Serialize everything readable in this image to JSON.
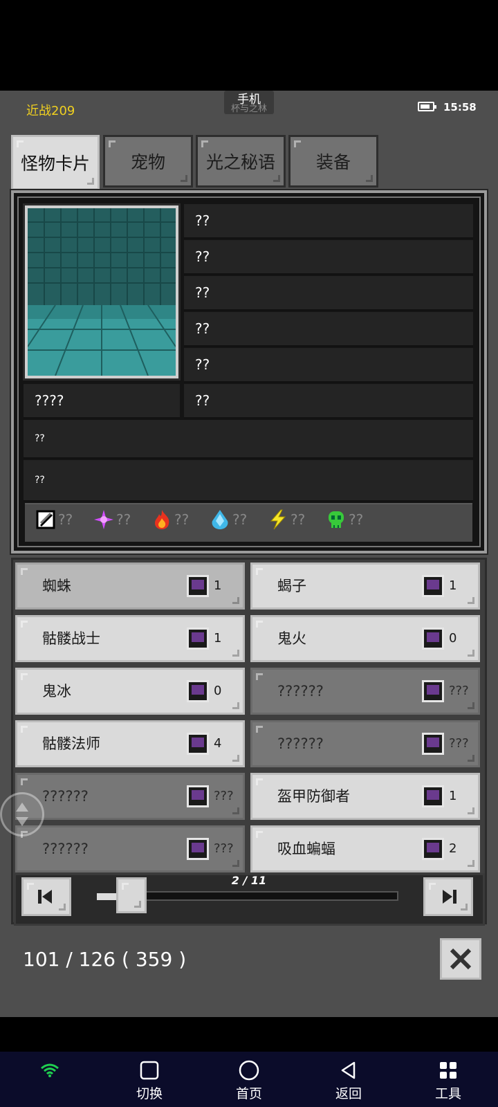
{
  "status": {
    "left_label": "近战209",
    "center_label": "手机",
    "center_sub": "杯与之林",
    "time": "15:58"
  },
  "tabs": [
    {
      "label": "怪物卡片",
      "active": true
    },
    {
      "label": "宠物",
      "active": false
    },
    {
      "label": "光之秘语",
      "active": false
    },
    {
      "label": "装备",
      "active": false
    }
  ],
  "info": {
    "right_rows": [
      "??",
      "??",
      "??",
      "??",
      "??",
      "??"
    ],
    "name": "????",
    "desc1": "??",
    "desc2": "??",
    "elements": [
      {
        "icon": "sword-icon",
        "value": "??"
      },
      {
        "icon": "arcane-star-icon",
        "value": "??"
      },
      {
        "icon": "fire-icon",
        "value": "??"
      },
      {
        "icon": "water-drop-icon",
        "value": "??"
      },
      {
        "icon": "lightning-icon",
        "value": "??"
      },
      {
        "icon": "skull-poison-icon",
        "value": "??"
      }
    ]
  },
  "monsters": [
    {
      "name": "蜘蛛",
      "count": "1",
      "state": "selected"
    },
    {
      "name": "蝎子",
      "count": "1",
      "state": "normal"
    },
    {
      "name": "骷髅战士",
      "count": "1",
      "state": "normal"
    },
    {
      "name": "鬼火",
      "count": "0",
      "state": "normal"
    },
    {
      "name": "鬼冰",
      "count": "0",
      "state": "normal"
    },
    {
      "name": "??????",
      "count": "???",
      "state": "locked"
    },
    {
      "name": "骷髅法师",
      "count": "4",
      "state": "normal"
    },
    {
      "name": "??????",
      "count": "???",
      "state": "locked"
    },
    {
      "name": "??????",
      "count": "???",
      "state": "locked"
    },
    {
      "name": "盔甲防御者",
      "count": "1",
      "state": "normal"
    },
    {
      "name": "??????",
      "count": "???",
      "state": "locked"
    },
    {
      "name": "吸血蝙蝠",
      "count": "2",
      "state": "normal"
    }
  ],
  "pager": {
    "indicator": "2 / 11",
    "progress": 0.09
  },
  "totals": "101 / 126 ( 359 )",
  "nav": {
    "switch": "切换",
    "home": "首页",
    "back": "返回",
    "tools": "工具"
  },
  "colors": {
    "accent_yellow": "#f0d020",
    "panel_bg": "#141414",
    "card_bg": "#dadada",
    "locked_card_bg": "#777777",
    "wifi_green": "#1fcf4f"
  }
}
